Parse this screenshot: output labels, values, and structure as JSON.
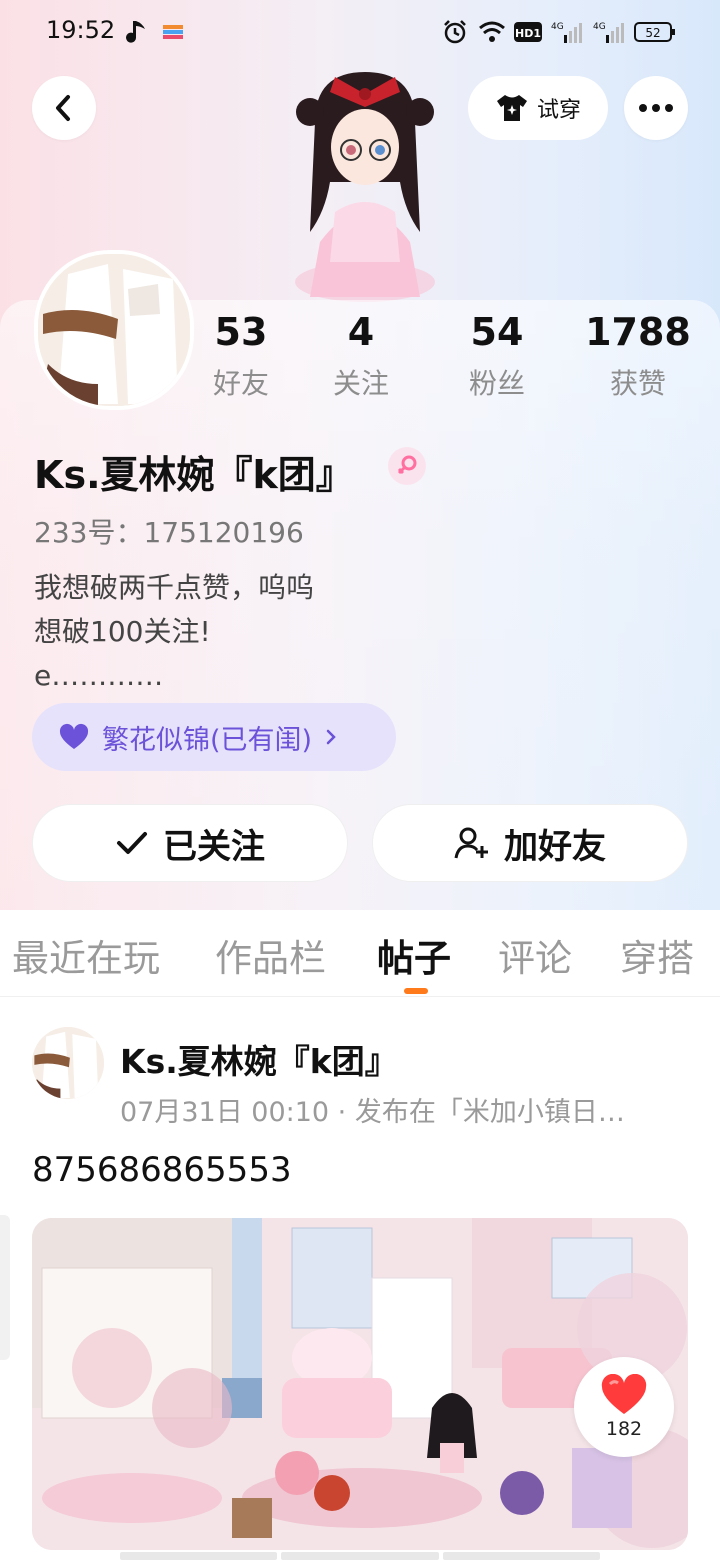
{
  "status_bar": {
    "time": "19:52",
    "network": [
      "4G",
      "4G"
    ],
    "hd_label": "HD1",
    "battery": "52",
    "icons": [
      "music-note-icon",
      "app-notification-icon",
      "alarm-icon",
      "wifi-icon",
      "hd-icon",
      "signal-icon",
      "signal-icon",
      "battery-icon"
    ]
  },
  "header": {
    "back_icon": "chevron-left-icon",
    "try_on_label": "试穿",
    "try_on_icon": "tshirt-icon",
    "more_icon": "more-dots-icon"
  },
  "profile": {
    "name": "Ks.夏林婉『k团』",
    "gender": "female",
    "uid": "233号：175120196",
    "bio_lines": [
      "我想破两千点赞，呜呜",
      "想破100关注!",
      "e…………"
    ],
    "badge_label": "繁花似锦(已有闺)",
    "stats": [
      {
        "value": "53",
        "label": "好友"
      },
      {
        "value": "4",
        "label": "关注"
      },
      {
        "value": "54",
        "label": "粉丝"
      },
      {
        "value": "1788",
        "label": "获赞"
      }
    ],
    "follow_label": "已关注",
    "add_friend_label": "加好友"
  },
  "tabs": [
    {
      "label": "最近在玩",
      "active": false
    },
    {
      "label": "作品栏",
      "active": false
    },
    {
      "label": "帖子",
      "active": true
    },
    {
      "label": "评论",
      "active": false
    },
    {
      "label": "穿搭",
      "active": false
    }
  ],
  "post": {
    "author": "Ks.夏林婉『k团』",
    "meta": "07月31日 00:10 · 发布在「米加小镇日…",
    "text": "875686865553",
    "likes": "182"
  },
  "colors": {
    "accent_orange": "#ff7a1a",
    "badge_purple": "#6b52d8",
    "like_red": "#ff3b3b"
  }
}
